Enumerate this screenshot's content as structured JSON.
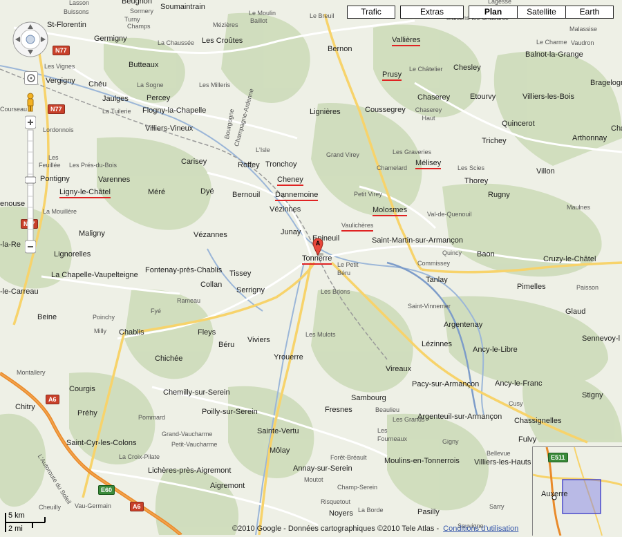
{
  "map_types": {
    "traffic": "Trafic",
    "extras": "Extras",
    "plan": "Plan",
    "satellite": "Satellite",
    "earth": "Earth",
    "active": "Plan"
  },
  "marker": {
    "label": "A",
    "place": "Tonnerre"
  },
  "roads": [
    {
      "label": "N77"
    },
    {
      "label": "N77"
    },
    {
      "label": "N77"
    },
    {
      "label": "A6"
    },
    {
      "label": "A6"
    },
    {
      "label": "E60"
    },
    {
      "label": "E511"
    }
  ],
  "road_names": {
    "autoroute": "L'Autoroute du Soleil",
    "bourgogne": "Bourgogne",
    "champagne": "Champagne-Ardenne"
  },
  "places": [
    {
      "name": "Lasson"
    },
    {
      "name": "Beugnon"
    },
    {
      "name": "Sormery"
    },
    {
      "name": "Buissons"
    },
    {
      "name": "Soumaintrain"
    },
    {
      "name": "Le Moulin"
    },
    {
      "name": "Baillot"
    },
    {
      "name": "Le Breuil"
    },
    {
      "name": "Lagesse"
    },
    {
      "name": "Maisons-lès-Chaource"
    },
    {
      "name": "St-Florentin"
    },
    {
      "name": "Germigny"
    },
    {
      "name": "Turny"
    },
    {
      "name": "Champs"
    },
    {
      "name": "Mézières"
    },
    {
      "name": "La Chaussée"
    },
    {
      "name": "Les Croûtes"
    },
    {
      "name": "Vallières"
    },
    {
      "name": "Bernon"
    },
    {
      "name": "Malassise"
    },
    {
      "name": "Le Charme"
    },
    {
      "name": "Vaudron"
    },
    {
      "name": "Balnot-la-Grange"
    },
    {
      "name": "Butteaux"
    },
    {
      "name": "Les Vignes"
    },
    {
      "name": "Vergigny"
    },
    {
      "name": "Chéu"
    },
    {
      "name": "La Sogne"
    },
    {
      "name": "Les Milleris"
    },
    {
      "name": "Le Châtelier"
    },
    {
      "name": "Chesley"
    },
    {
      "name": "Prusy"
    },
    {
      "name": "Bragelogne"
    },
    {
      "name": "Jaulges"
    },
    {
      "name": "Percey"
    },
    {
      "name": "Chaserey"
    },
    {
      "name": "Etourvy"
    },
    {
      "name": "Villiers-les-Bois"
    },
    {
      "name": "Courseau"
    },
    {
      "name": "La Tuilerie"
    },
    {
      "name": "Flogny-la-Chapelle"
    },
    {
      "name": "Lignières"
    },
    {
      "name": "Coussegrey"
    },
    {
      "name": "Chaserey Haut"
    },
    {
      "name": "Lordonnois"
    },
    {
      "name": "Villiers-Vineux"
    },
    {
      "name": "Quincerot"
    },
    {
      "name": "Chau"
    },
    {
      "name": "Arthonnay"
    },
    {
      "name": "Trichey"
    },
    {
      "name": "L'Isle"
    },
    {
      "name": "Grand Virey"
    },
    {
      "name": "Les Graveries"
    },
    {
      "name": "Les"
    },
    {
      "name": "Feuillée"
    },
    {
      "name": "Les Prés-du-Bois"
    },
    {
      "name": "Carisey"
    },
    {
      "name": "Roffey"
    },
    {
      "name": "Tronchoy"
    },
    {
      "name": "Chamelard"
    },
    {
      "name": "Mélisey"
    },
    {
      "name": "Les Scies"
    },
    {
      "name": "Villon"
    },
    {
      "name": "Pontigny"
    },
    {
      "name": "Varennes"
    },
    {
      "name": "Cheney"
    },
    {
      "name": "Thorey"
    },
    {
      "name": "Ligny-le-Châtel"
    },
    {
      "name": "Méré"
    },
    {
      "name": "Dyé"
    },
    {
      "name": "Bernouil"
    },
    {
      "name": "Dannemoine"
    },
    {
      "name": "Petit Virey"
    },
    {
      "name": "Rugny"
    },
    {
      "name": "enouse"
    },
    {
      "name": "La Mouillère"
    },
    {
      "name": "Vézinnes"
    },
    {
      "name": "Molosmes"
    },
    {
      "name": "Maulnes"
    },
    {
      "name": "Val-de-Quenouil"
    },
    {
      "name": "Vaulichères"
    },
    {
      "name": "Maligny"
    },
    {
      "name": "Vézannes"
    },
    {
      "name": "Junay"
    },
    {
      "name": "Epineuil"
    },
    {
      "name": "Saint-Martin-sur-Armançon"
    },
    {
      "name": "-la-Re"
    },
    {
      "name": "Lignorelles"
    },
    {
      "name": "Tonnerre"
    },
    {
      "name": "Quincy"
    },
    {
      "name": "Baon"
    },
    {
      "name": "Cruzy-le-Châtel"
    },
    {
      "name": "Commissey"
    },
    {
      "name": "Le Petit Béru"
    },
    {
      "name": "Fontenay-près-Chablis"
    },
    {
      "name": "Tissey"
    },
    {
      "name": "La Chapelle-Vaupelteigne"
    },
    {
      "name": "Tanlay"
    },
    {
      "name": "Pimelles"
    },
    {
      "name": "Paisson"
    },
    {
      "name": "-le-Carreau"
    },
    {
      "name": "Collan"
    },
    {
      "name": "Serrigny"
    },
    {
      "name": "Les Brions"
    },
    {
      "name": "Rameau"
    },
    {
      "name": "Saint-Vinnemer"
    },
    {
      "name": "Fyé"
    },
    {
      "name": "Glaud"
    },
    {
      "name": "Beine"
    },
    {
      "name": "Poinchy"
    },
    {
      "name": "Argentenay"
    },
    {
      "name": "Sennevoy-l"
    },
    {
      "name": "Milly"
    },
    {
      "name": "Chablis"
    },
    {
      "name": "Fleys"
    },
    {
      "name": "Les Mulots"
    },
    {
      "name": "Béru"
    },
    {
      "name": "Viviers"
    },
    {
      "name": "Lézinnes"
    },
    {
      "name": "Ancy-le-Libre"
    },
    {
      "name": "Chichée"
    },
    {
      "name": "Yrouerre"
    },
    {
      "name": "Montallery"
    },
    {
      "name": "Vireaux"
    },
    {
      "name": "Pacy-sur-Armançon"
    },
    {
      "name": "Ancy-le-Franc"
    },
    {
      "name": "Courgis"
    },
    {
      "name": "Chemilly-sur-Serein"
    },
    {
      "name": "Sambourg"
    },
    {
      "name": "Stigny"
    },
    {
      "name": "Cusy"
    },
    {
      "name": "Chitry"
    },
    {
      "name": "Fresnes"
    },
    {
      "name": "Beaulieu"
    },
    {
      "name": "Préhy"
    },
    {
      "name": "Poilly-sur-Serein"
    },
    {
      "name": "Pommard"
    },
    {
      "name": "Les Grands"
    },
    {
      "name": "Argenteuil-sur-Armançon"
    },
    {
      "name": "Chassignelles"
    },
    {
      "name": "Grand-Vaucharme"
    },
    {
      "name": "Sainte-Vertu"
    },
    {
      "name": "Les Fourneaux"
    },
    {
      "name": "Saint-Cyr-les-Colons"
    },
    {
      "name": "Petit-Vaucharme"
    },
    {
      "name": "Gigny"
    },
    {
      "name": "Fulvy"
    },
    {
      "name": "La Croix-Pilate"
    },
    {
      "name": "Môlay"
    },
    {
      "name": "Bellevue"
    },
    {
      "name": "Forêt-Bréault"
    },
    {
      "name": "Moulins-en-Tonnerrois"
    },
    {
      "name": "Villiers-les-Hauts"
    },
    {
      "name": "Lichères-près-Aigremont"
    },
    {
      "name": "Annay-sur-Serein"
    },
    {
      "name": "Moutot"
    },
    {
      "name": "Aigremont"
    },
    {
      "name": "Champ-Serein"
    },
    {
      "name": "Cheuilly"
    },
    {
      "name": "Vau-Germain"
    },
    {
      "name": "Risquetout"
    },
    {
      "name": "La Borde"
    },
    {
      "name": "Noyers"
    },
    {
      "name": "Pasilly"
    },
    {
      "name": "Sarry"
    },
    {
      "name": "Sauvigne"
    },
    {
      "name": "Auxerre"
    }
  ],
  "copyright": "©2010 Google - Données cartographiques ©2010 Tele Atlas -",
  "terms_link": "Conditions d'utilisation",
  "scale": {
    "km": "5 km",
    "mi": "2 mi"
  },
  "overview_label": "Auxerre"
}
